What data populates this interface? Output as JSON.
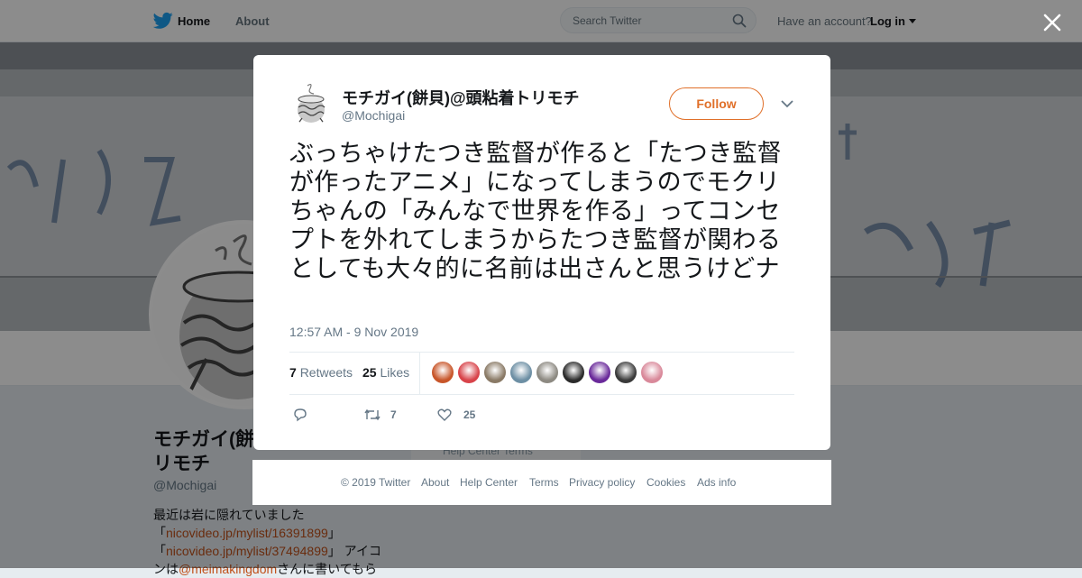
{
  "topbar": {
    "home_label": "Home",
    "about_label": "About",
    "search_placeholder": "Search Twitter",
    "have_account": "Have an account?",
    "login_label": "Log in"
  },
  "profile": {
    "name": "モチガイ(餅貝)@頭粘着トリモチ",
    "name_visible_line1": "モチガイ(餅",
    "name_visible_line2": "リモチ",
    "handle": "@Mochigai",
    "bio_line1": "最近は岩に隠れていました",
    "bio_link1": "nicovideo.jp/mylist/16391899",
    "bio_link2": "nicovideo.jp/mylist/37494899",
    "bio_line3_suffix": "アイコ",
    "bio_line4_prefix": "ンは",
    "bio_mention": "@meimakingdom",
    "bio_line4_suffix": "さんに書いてもら",
    "ghost_links": "Help Center   Terms"
  },
  "tweet": {
    "author_name": "モチガイ(餅貝)@頭粘着トリモチ",
    "author_handle": "@Mochigai",
    "follow_label": "Follow",
    "text": "ぶっちゃけたつき監督が作ると「たつき監督が作ったアニメ」になってしまうのでモクリちゃんの「みんなで世界を作る」ってコンセプトを外れてしまうからたつき監督が関わるとしても大々的に名前は出さんと思うけどナ",
    "timestamp": "12:57 AM - 9 Nov 2019",
    "retweets_count": "7",
    "retweets_label": "Retweets",
    "likes_count": "25",
    "likes_label": "Likes",
    "action_retweet_count": "7",
    "action_like_count": "25"
  },
  "likers": [
    {
      "name": "liker-1",
      "color": "#c8562a"
    },
    {
      "name": "liker-2",
      "color": "#d8434a"
    },
    {
      "name": "liker-3",
      "color": "#8a7a66"
    },
    {
      "name": "liker-4",
      "color": "#6d8fa4"
    },
    {
      "name": "liker-5",
      "color": "#8d8a82"
    },
    {
      "name": "liker-6",
      "color": "#2b2b2b"
    },
    {
      "name": "liker-7",
      "color": "#6a2a9a"
    },
    {
      "name": "liker-8",
      "color": "#3a3a3a"
    },
    {
      "name": "liker-9",
      "color": "#d9899a"
    }
  ],
  "footer": {
    "copyright": "© 2019 Twitter",
    "about": "About",
    "help": "Help Center",
    "terms": "Terms",
    "privacy": "Privacy policy",
    "cookies": "Cookies",
    "ads": "Ads info"
  },
  "colors": {
    "accent": "#e0702a",
    "link": "#c0501a",
    "twitter_blue": "#1da1f2"
  }
}
